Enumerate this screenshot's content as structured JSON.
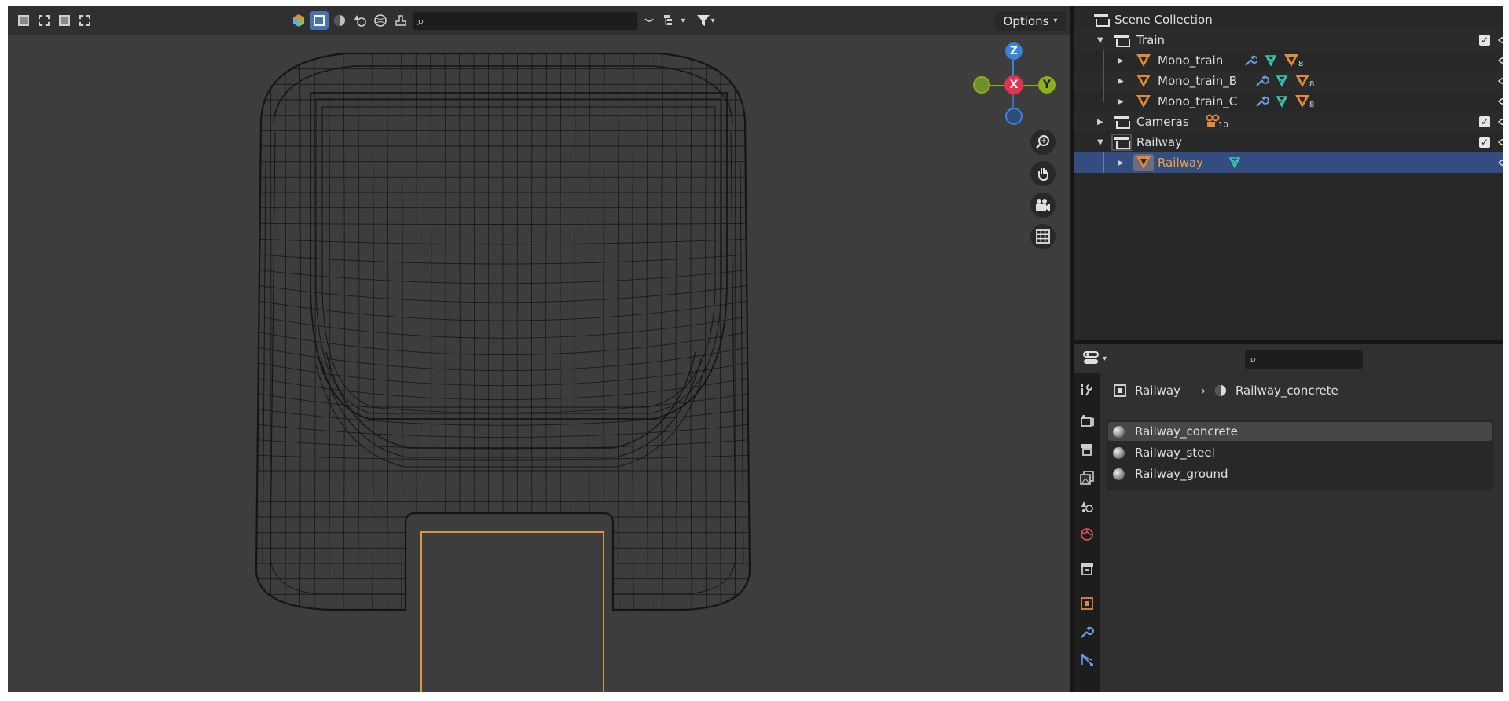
{
  "viewport": {
    "search": {
      "value": "",
      "placeholder": ""
    },
    "options_label": "Options",
    "gizmo": {
      "z": "Z",
      "x": "X",
      "y": "Y"
    },
    "nav_icons": [
      "zoom-icon",
      "hand-pan-icon",
      "camera-icon",
      "grid-icon"
    ]
  },
  "outliner": {
    "root_label": "Scene Collection",
    "rows": [
      {
        "label": "Train",
        "type": "collection",
        "expanded": true
      },
      {
        "label": "Mono_train",
        "type": "mesh",
        "modifiers_count": "8"
      },
      {
        "label": "Mono_train_B",
        "type": "mesh",
        "modifiers_count": "8"
      },
      {
        "label": "Mono_train_C",
        "type": "mesh",
        "modifiers_count": "8"
      },
      {
        "label": "Cameras",
        "type": "collection",
        "count": "10"
      },
      {
        "label": "Railway",
        "type": "collection",
        "expanded": true
      },
      {
        "label": "Railway",
        "type": "mesh",
        "selected": true
      }
    ]
  },
  "properties": {
    "search": {
      "value": "",
      "placeholder": ""
    },
    "breadcrumb": {
      "object": "Railway",
      "material": "Railway_concrete"
    },
    "materials": [
      "Railway_concrete",
      "Railway_steel",
      "Railway_ground"
    ],
    "active_material_index": 0
  },
  "colors": {
    "accent": "#4772b3",
    "selection_row": "#334d80",
    "object_orange": "#e08a3a",
    "selected_outline": "#e8a33a",
    "gizmo_x": "#e5334d",
    "gizmo_y": "#8bb21c",
    "gizmo_z": "#3b82d6"
  }
}
